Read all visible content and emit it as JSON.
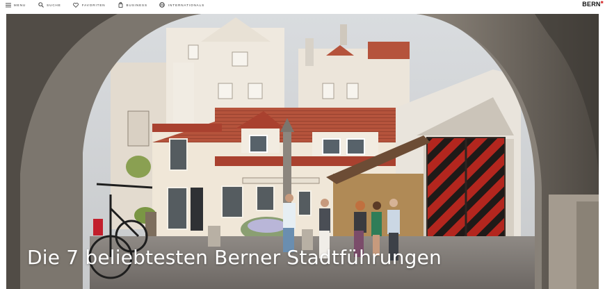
{
  "nav": {
    "items": [
      {
        "label": "MENU",
        "icon": "menu-icon"
      },
      {
        "label": "SUCHE",
        "icon": "search-icon"
      },
      {
        "label": "FAVORITEN",
        "icon": "heart-icon"
      },
      {
        "label": "BUSINESS",
        "icon": "briefcase-icon"
      },
      {
        "label": "INTERNATIONALS",
        "icon": "globe-icon"
      }
    ],
    "logo": "BERN"
  },
  "hero": {
    "title": "Die 7 beliebtesten Berner Stadtführungen"
  },
  "colors": {
    "accent": "#d62828",
    "door_red": "#b3261e",
    "door_black": "#1f1a18",
    "roof": "#b5533c",
    "stone": "#a9a39a"
  }
}
